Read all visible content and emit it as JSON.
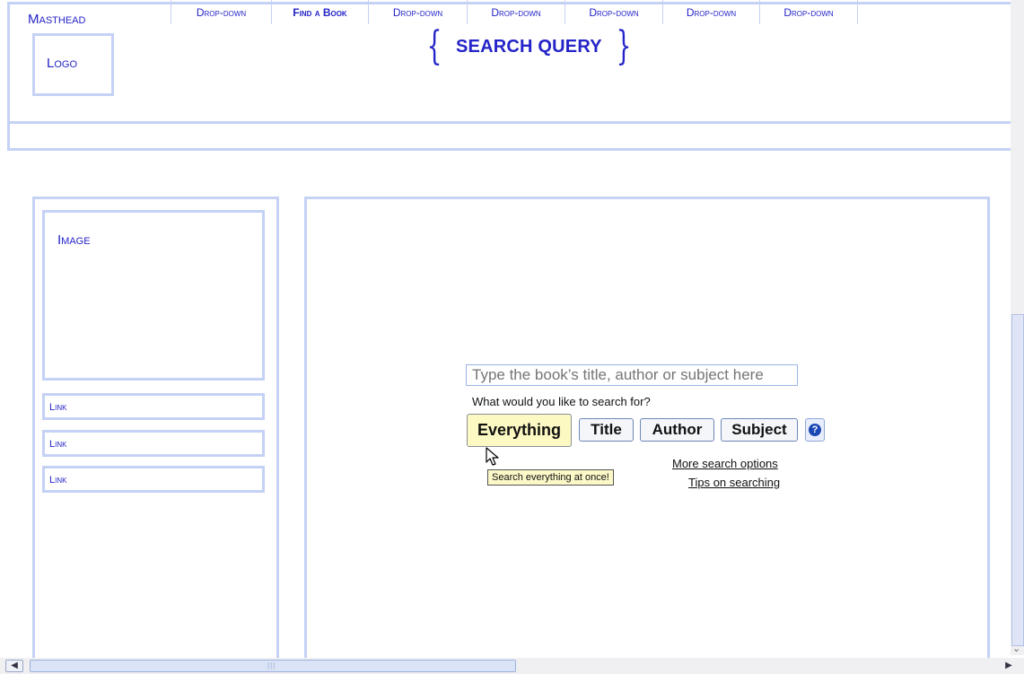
{
  "masthead": {
    "label": "Masthead",
    "logo_label": "Logo",
    "search_query": "SEARCH QUERY"
  },
  "nav": {
    "items": [
      {
        "label": "Drop-down"
      },
      {
        "label": "Find a Book"
      },
      {
        "label": "Drop-down"
      },
      {
        "label": "Drop-down"
      },
      {
        "label": "Drop-down"
      },
      {
        "label": "Drop-down"
      },
      {
        "label": "Drop-down"
      }
    ]
  },
  "sidebar": {
    "image_label": "Image",
    "links": [
      {
        "label": "Link"
      },
      {
        "label": "Link"
      },
      {
        "label": "Link"
      }
    ]
  },
  "search": {
    "input_placeholder": "Type the book’s title, author or subject here",
    "question": "What would you like to search for?",
    "scopes": {
      "everything": "Everything",
      "title": "Title",
      "author": "Author",
      "subject": "Subject"
    },
    "selected_scope": "Everything",
    "help_icon": "?",
    "tooltip": "Search everything at once!",
    "more_options": "More search options",
    "tips": "Tips on searching"
  },
  "colors": {
    "wireframe_border": "#c5d2f5",
    "label_blue": "#2424c8",
    "selected_button": "#fdf9c2",
    "tooltip_bg": "#fcf8c8"
  },
  "icons": {
    "help": "help-icon",
    "cursor": "mouse-pointer-icon",
    "scroll_left": "arrow-left-icon",
    "scroll_right": "arrow-right-icon",
    "scroll_down": "arrow-down-icon"
  }
}
